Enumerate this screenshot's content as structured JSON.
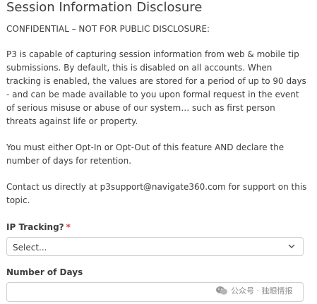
{
  "page": {
    "title": "Session Information Disclosure",
    "confidential_notice": "CONFIDENTIAL – NOT FOR PUBLIC DISCLOSURE:",
    "paragraph_1": "P3 is capable of capturing session information from web & mobile tip submissions. By default, this is disabled on all accounts. When tracking is enabled, the values are stored for a period of up to 90 days - and can be made available to you upon formal request in the event of serious misuse or abuse of our system… such as first person threats against life or property.",
    "paragraph_2": "You must either Opt-In or Opt-Out of this feature AND declare the number of days for retention.",
    "paragraph_3": "Contact us directly at p3support@navigate360.com for support on this topic."
  },
  "form": {
    "ip_tracking": {
      "label": "IP Tracking?",
      "required_marker": "*",
      "selected_value": "Select..."
    },
    "number_of_days": {
      "label": "Number of Days",
      "value": ""
    }
  },
  "watermark": {
    "text": "公众号 · 独眼情报",
    "icon": "wechat-icon"
  },
  "colors": {
    "text": "#3d3d3d",
    "required": "#d9363e",
    "border": "#cfcfcf",
    "watermark": "#8a8a8a"
  }
}
